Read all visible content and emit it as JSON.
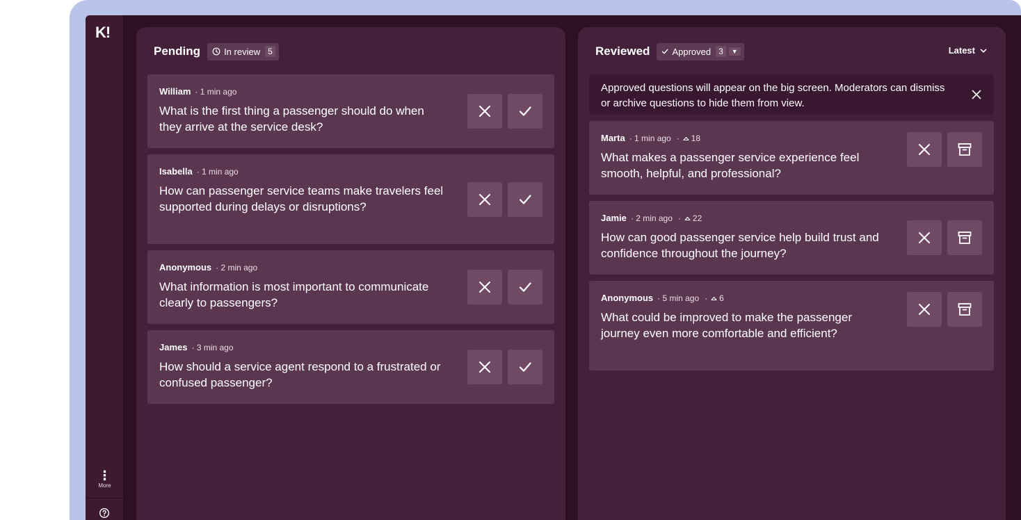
{
  "sidebar": {
    "logo": "K!",
    "more_label": "More"
  },
  "pending": {
    "title": "Pending",
    "filter_label": "In review",
    "filter_count": "5",
    "items": [
      {
        "author": "William",
        "time": "· 1 min ago",
        "question": "What is the first thing a passenger should do when they arrive at the service desk?"
      },
      {
        "author": "Isabella",
        "time": "· 1 min ago",
        "question": "How can passenger service teams make travelers feel supported during delays or disruptions?"
      },
      {
        "author": "Anonymous",
        "time": "· 2 min ago",
        "question": "What information is most important to communicate clearly to passengers?"
      },
      {
        "author": "James",
        "time": "· 3 min ago",
        "question": "How should a service agent respond to a frustrated or confused passenger?"
      }
    ]
  },
  "reviewed": {
    "title": "Reviewed",
    "filter_label": "Approved",
    "filter_count": "3",
    "sort_label": "Latest",
    "notice": "Approved questions will appear on the big screen. Moderators can dismiss or archive questions to hide them from view.",
    "items": [
      {
        "author": "Marta",
        "time": "· 1 min ago",
        "votes_prefix": "·",
        "votes": "18",
        "question": "What makes a passenger service experience feel smooth, helpful, and professional?"
      },
      {
        "author": "Jamie",
        "time": "· 2 min ago",
        "votes_prefix": "·",
        "votes": "22",
        "question": "How can good passenger service help build trust and confidence throughout the journey?"
      },
      {
        "author": "Anonymous",
        "time": "· 5 min ago",
        "votes_prefix": "·",
        "votes": "6",
        "question": "What could be improved to make the passenger journey even more comfortable and efficient?"
      }
    ]
  },
  "colors": {
    "background": "#2e1022",
    "panel": "#44213a",
    "card": "#5b3651",
    "button": "#704a65",
    "frame": "#b9c3ea"
  },
  "icons": {
    "reject": "close-icon",
    "approve": "check-icon",
    "archive": "archive-icon",
    "clock": "clock-icon",
    "upvote": "upvote-icon",
    "help": "help-icon"
  }
}
